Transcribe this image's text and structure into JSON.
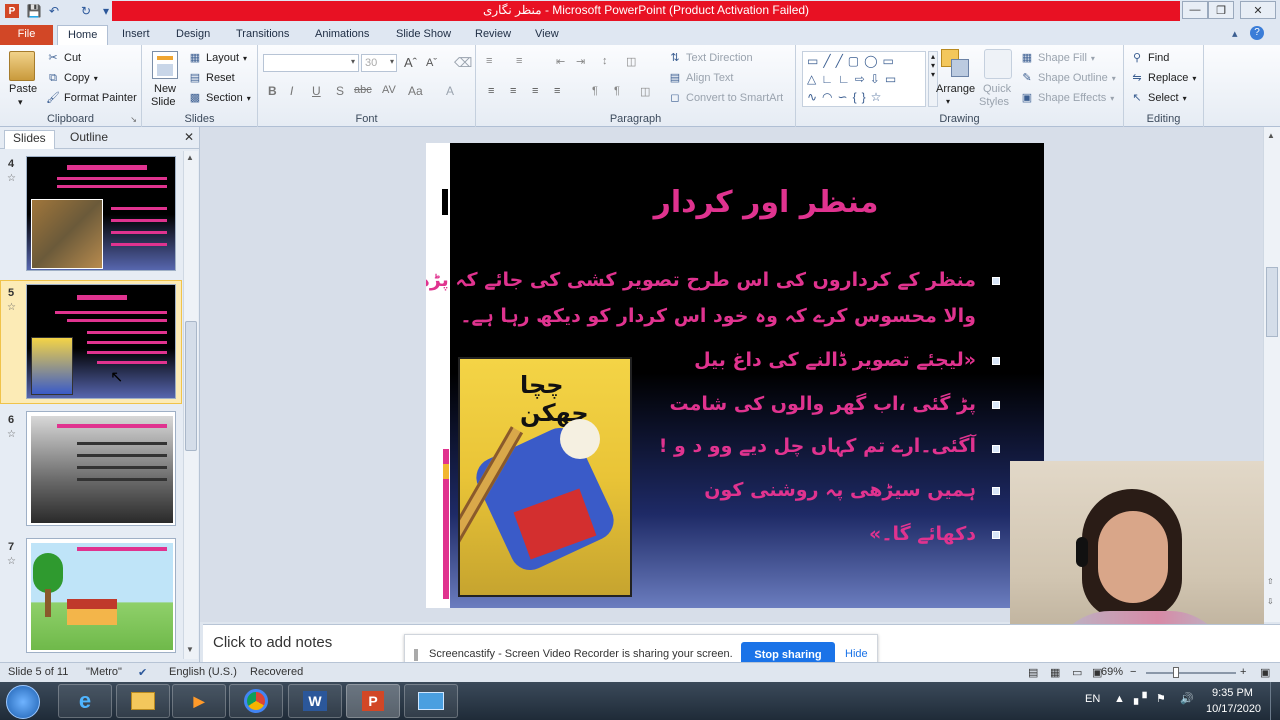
{
  "titlebar": {
    "title": "منظر نگاری - Microsoft PowerPoint (Product Activation Failed)"
  },
  "tabs": [
    "File",
    "Home",
    "Insert",
    "Design",
    "Transitions",
    "Animations",
    "Slide Show",
    "Review",
    "View"
  ],
  "ribbon": {
    "clipboard": {
      "paste": "Paste",
      "cut": "Cut",
      "copy": "Copy",
      "format_painter": "Format Painter",
      "label": "Clipboard"
    },
    "slides": {
      "new_slide_1": "New",
      "new_slide_2": "Slide",
      "layout": "Layout",
      "reset": "Reset",
      "section": "Section",
      "label": "Slides"
    },
    "font": {
      "font_size": "30",
      "label": "Font"
    },
    "paragraph": {
      "text_direction": "Text Direction",
      "align_text": "Align Text",
      "convert_smartart": "Convert to SmartArt",
      "label": "Paragraph"
    },
    "drawing": {
      "arrange": "Arrange",
      "quick_styles_1": "Quick",
      "quick_styles_2": "Styles",
      "shape_fill": "Shape Fill",
      "shape_outline": "Shape Outline",
      "shape_effects": "Shape Effects",
      "label": "Drawing"
    },
    "editing": {
      "find": "Find",
      "replace": "Replace",
      "select": "Select",
      "label": "Editing"
    }
  },
  "left_pane": {
    "tabs": [
      "Slides",
      "Outline"
    ],
    "slide_numbers": [
      "4",
      "5",
      "6",
      "7"
    ]
  },
  "slide": {
    "title": "منظر اور کردار",
    "lines": [
      "منظر کے کرداروں کی اس طرح تصویر کشی کی جائے کہ پڑھنے",
      "والا محسوس کرے کہ وہ خود اس کردار کو دیکھ رہا ہے۔",
      "«لیجئے تصویر ڈالنے کی داغ بیل",
      "پڑ گئی ،اب گھر والوں کی شامت",
      "آگئی۔ارے تم کہاں چل دیے وو د و !",
      "ہمیں سیڑھی پہ روشنی کون",
      "دکھائے گا۔»"
    ],
    "book_title": "چچا چھکن"
  },
  "notes": {
    "placeholder": "Click to add notes"
  },
  "castbar": {
    "message": "Screencastify - Screen Video Recorder is sharing your screen.",
    "stop": "Stop sharing",
    "hide": "Hide"
  },
  "status": {
    "slide_info": "Slide 5 of 11",
    "theme": "\"Metro\"",
    "language": "English (U.S.)",
    "recovered": "Recovered",
    "zoom": "69%"
  },
  "taskbar": {
    "lang": "EN",
    "time": "9:35 PM",
    "date": "10/17/2020"
  },
  "colors": {
    "accent_pink": "#e0338f",
    "file_tab": "#d24726",
    "title_red": "#e81123",
    "stop_blue": "#1a73e8"
  }
}
